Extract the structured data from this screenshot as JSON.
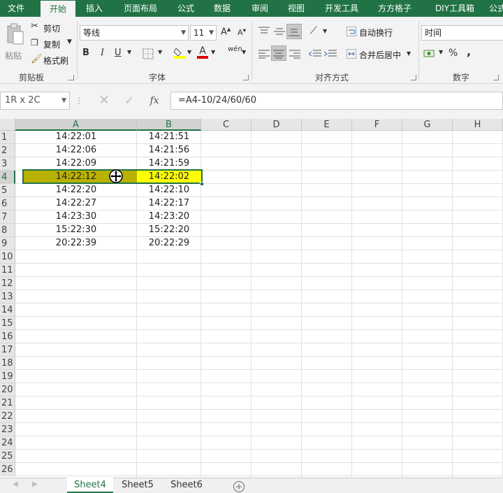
{
  "tabs": [
    "文件",
    "开始",
    "插入",
    "页面布局",
    "公式",
    "数据",
    "审阅",
    "视图",
    "开发工具",
    "方方格子",
    "DIY工具箱",
    "公式"
  ],
  "ribbon": {
    "paste": "粘贴",
    "cut": "剪切",
    "copy": "复制",
    "format_painter": "格式刷",
    "clipboard_label": "剪贴板",
    "font_name": "等线",
    "font_size": "11",
    "bold": "B",
    "italic": "I",
    "underline": "U",
    "font_label": "字体",
    "wrap_text": "自动换行",
    "merge_center": "合并后居中",
    "align_label": "对齐方式",
    "number_format": "时间",
    "percent": "%",
    "comma": ",",
    "number_label": "数字"
  },
  "formula_bar": {
    "name_box": "1R x 2C",
    "fx": "fx",
    "formula": "=A4-10/24/60/60"
  },
  "grid": {
    "columns": [
      "A",
      "B",
      "C",
      "D",
      "E",
      "F",
      "G",
      "H"
    ],
    "rows": [
      "1",
      "2",
      "3",
      "4",
      "5",
      "6",
      "7",
      "8",
      "9",
      "10",
      "11",
      "12",
      "13",
      "14",
      "15",
      "16",
      "17",
      "18",
      "19",
      "20",
      "21",
      "22",
      "23",
      "24",
      "25",
      "26"
    ],
    "data": [
      [
        "14:22:01",
        "14:21:51"
      ],
      [
        "14:22:06",
        "14:21:56"
      ],
      [
        "14:22:09",
        "14:21:59"
      ],
      [
        "14:22:12",
        "14:22:02"
      ],
      [
        "14:22:20",
        "14:22:10"
      ],
      [
        "14:22:27",
        "14:22:17"
      ],
      [
        "14:23:30",
        "14:23:20"
      ],
      [
        "15:22:30",
        "15:22:20"
      ],
      [
        "20:22:39",
        "20:22:29"
      ]
    ],
    "selected_row": 4,
    "colors": {
      "selected_a": "#b9b100",
      "selected_b": "#ffff00",
      "accent": "#217346"
    }
  },
  "sheets": [
    "Sheet4",
    "Sheet5",
    "Sheet6"
  ],
  "active_sheet": "Sheet4"
}
